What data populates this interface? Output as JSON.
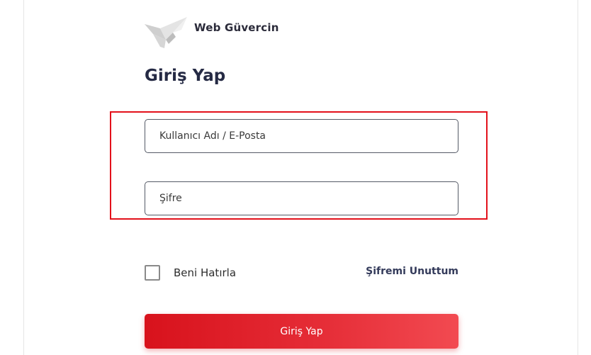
{
  "header": {
    "brand_name": "Web Güvercin",
    "logo_icon": "dove-logo-icon"
  },
  "login": {
    "title": "Giriş Yap",
    "username_placeholder": "Kullanıcı Adı / E-Posta",
    "username_value": "",
    "password_placeholder": "Şifre",
    "password_value": "",
    "remember_label": "Beni Hatırla",
    "remember_checked": false,
    "forgot_label": "Şifremi Unuttum",
    "submit_label": "Giriş Yap"
  },
  "colors": {
    "accent": "#e3111b",
    "title": "#252a44",
    "button_start": "#d8121c",
    "button_end": "#f24a51"
  }
}
